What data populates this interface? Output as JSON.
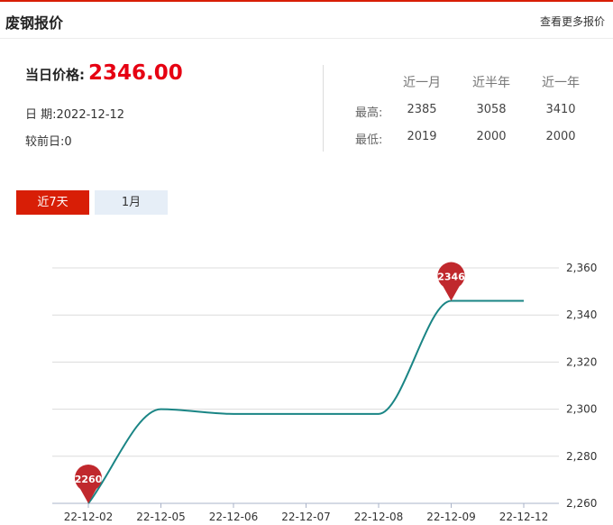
{
  "header": {
    "title": "废钢报价",
    "more_link": "查看更多报价"
  },
  "price": {
    "label": "当日价格:",
    "value": "2346.00",
    "date_label": "日 期:",
    "date": "2022-12-12",
    "change_label": "较前日:",
    "change": "0"
  },
  "stats": {
    "columns": [
      "近一月",
      "近半年",
      "近一年"
    ],
    "rows": [
      {
        "label": "最高:",
        "values": [
          "2385",
          "3058",
          "3410"
        ]
      },
      {
        "label": "最低:",
        "values": [
          "2019",
          "2000",
          "2000"
        ]
      }
    ]
  },
  "tabs": [
    {
      "label": "近7天"
    },
    {
      "label": "1月"
    }
  ],
  "colors": {
    "accent": "#d81e06",
    "price": "#e60012",
    "line": "#1a8585",
    "marker": "#c0282d",
    "tab_inactive": "#e6eef7"
  },
  "chart_data": {
    "type": "line",
    "categories": [
      "22-12-02",
      "22-12-05",
      "22-12-06",
      "22-12-07",
      "22-12-08",
      "22-12-09",
      "22-12-12"
    ],
    "series": [
      {
        "values": [
          2260,
          2300,
          2298,
          2298,
          2298,
          2346,
          2346
        ]
      }
    ],
    "ylim": [
      2260,
      2360
    ],
    "yticks": [
      2260,
      2280,
      2300,
      2320,
      2340,
      2360
    ],
    "ytick_labels": [
      "2,260",
      "2,280",
      "2,300",
      "2,320",
      "2,340",
      "2,360"
    ],
    "markers": [
      {
        "category": "22-12-02",
        "value": 2260,
        "label": "2260"
      },
      {
        "category": "22-12-09",
        "value": 2346,
        "label": "2346"
      }
    ],
    "grid": true,
    "y_axis_side": "right"
  }
}
